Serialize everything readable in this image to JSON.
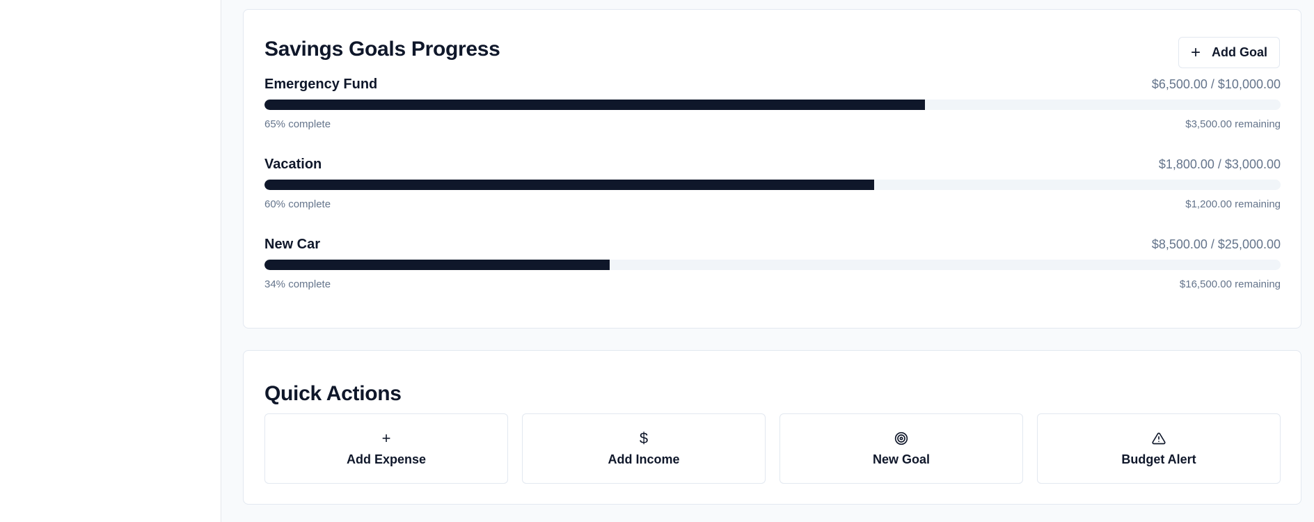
{
  "savings_goals": {
    "title": "Savings Goals Progress",
    "add_goal_label": "Add Goal",
    "goals": [
      {
        "name": "Emergency Fund",
        "amount": "$6,500.00 / $10,000.00",
        "progress": 65,
        "percent_text": "65% complete",
        "remaining_text": "$3,500.00 remaining"
      },
      {
        "name": "Vacation",
        "amount": "$1,800.00 / $3,000.00",
        "progress": 60,
        "percent_text": "60% complete",
        "remaining_text": "$1,200.00 remaining"
      },
      {
        "name": "New Car",
        "amount": "$8,500.00 / $25,000.00",
        "progress": 34,
        "percent_text": "34% complete",
        "remaining_text": "$16,500.00 remaining"
      }
    ]
  },
  "quick_actions": {
    "title": "Quick Actions",
    "items": [
      {
        "label": "Add Expense",
        "icon": "plus-icon"
      },
      {
        "label": "Add Income",
        "icon": "dollar-icon"
      },
      {
        "label": "New Goal",
        "icon": "target-icon"
      },
      {
        "label": "Budget Alert",
        "icon": "alert-triangle-icon"
      }
    ]
  },
  "colors": {
    "progress_fill": "#0f172a",
    "progress_track": "#f1f5f9",
    "muted_text": "#64748b"
  }
}
